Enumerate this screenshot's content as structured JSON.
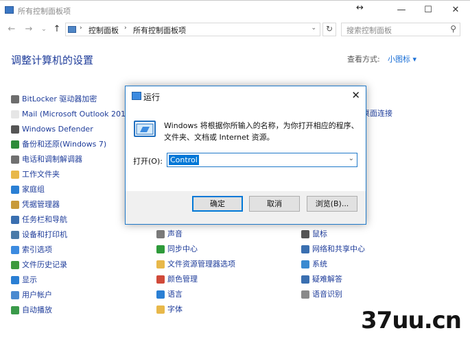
{
  "window": {
    "title": "所有控制面板项",
    "controls": {
      "minimize": "—",
      "maximize": "☐",
      "close": "✕",
      "move": "↔"
    }
  },
  "address": {
    "back": "←",
    "forward": "→",
    "dropdown": "⌄",
    "up": "↑",
    "separator": "›",
    "crumbs": [
      "控制面板",
      "所有控制面板项"
    ],
    "refresh": "↻",
    "search_placeholder": "搜索控制面板",
    "search_icon": "⚲"
  },
  "content": {
    "heading": "调整计算机的设置",
    "view_by_label": "查看方式:",
    "view_by_value": "小图标 ▾"
  },
  "items": {
    "col1": [
      {
        "label": "BitLocker 驱动器加密",
        "icon": "bitlocker-icon",
        "color": "#6d6d6d"
      },
      {
        "label": "Mail (Microsoft Outlook 2016",
        "icon": "mail-icon",
        "color": "#e6e6e6"
      },
      {
        "label": "Windows Defender",
        "icon": "defender-icon",
        "color": "#555555"
      },
      {
        "label": "备份和还原(Windows 7)",
        "icon": "backup-icon",
        "color": "#2e8b3a"
      },
      {
        "label": "电话和调制解调器",
        "icon": "phone-icon",
        "color": "#707070"
      },
      {
        "label": "工作文件夹",
        "icon": "work-folders-icon",
        "color": "#e8b84a"
      },
      {
        "label": "家庭组",
        "icon": "homegroup-icon",
        "color": "#2a7fd4"
      },
      {
        "label": "凭据管理器",
        "icon": "credential-icon",
        "color": "#c89a3a"
      },
      {
        "label": "任务栏和导航",
        "icon": "taskbar-icon",
        "color": "#3a6fb0"
      },
      {
        "label": "设备和打印机",
        "icon": "devices-icon",
        "color": "#4a7aa8"
      },
      {
        "label": "索引选项",
        "icon": "index-icon",
        "color": "#3c8be0"
      },
      {
        "label": "文件历史记录",
        "icon": "file-history-icon",
        "color": "#3d9a3d"
      },
      {
        "label": "显示",
        "icon": "display-icon",
        "color": "#2a7fd4"
      },
      {
        "label": "用户帐户",
        "icon": "user-accounts-icon",
        "color": "#4a8ad0"
      },
      {
        "label": "自动播放",
        "icon": "autoplay-icon",
        "color": "#3a9a4a"
      }
    ],
    "col2": [
      {
        "label": "声音",
        "icon": "sound-icon",
        "color": "#7a7a7a"
      },
      {
        "label": "同步中心",
        "icon": "sync-icon",
        "color": "#2e9a3a"
      },
      {
        "label": "文件资源管理器选项",
        "icon": "explorer-options-icon",
        "color": "#e8b84a"
      },
      {
        "label": "颜色管理",
        "icon": "color-icon",
        "color": "#d04a3a"
      },
      {
        "label": "语言",
        "icon": "language-icon",
        "color": "#2a7fd4"
      },
      {
        "label": "字体",
        "icon": "font-icon",
        "color": "#e8b84a"
      }
    ],
    "col3": [
      {
        "label": "鼠标",
        "icon": "mouse-icon",
        "color": "#555555"
      },
      {
        "label": "网络和共享中心",
        "icon": "network-icon",
        "color": "#3a6fb0"
      },
      {
        "label": "系统",
        "icon": "system-icon",
        "color": "#3a8ad0"
      },
      {
        "label": "疑难解答",
        "icon": "troubleshoot-icon",
        "color": "#3a6fb0"
      },
      {
        "label": "语音识别",
        "icon": "speech-icon",
        "color": "#8a8a8a"
      }
    ],
    "partial_right": "桌面连接"
  },
  "run_dialog": {
    "title": "运行",
    "close": "✕",
    "description_line1": "Windows 将根据你所输入的名称，为你打开相应的程序、",
    "description_line2": "文件夹、文档或 Internet 资源。",
    "open_label": "打开(O):",
    "open_value": "Control",
    "ok": "确定",
    "cancel": "取消",
    "browse": "浏览(B)..."
  },
  "watermark": "37uu.cn"
}
